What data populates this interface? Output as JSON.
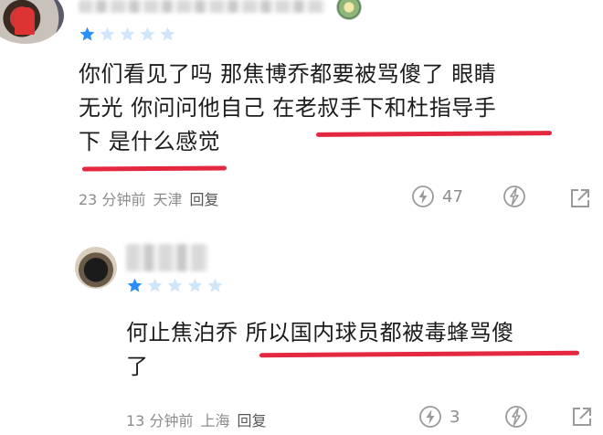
{
  "colors": {
    "star_filled": "#2c8ef8",
    "star_empty": "#cfe6fb",
    "highlight_underline": "#e3283f",
    "meta_text": "#8c8c8c"
  },
  "comments": [
    {
      "rating": 1,
      "lines": [
        "你们看见了吗 那焦博乔都要被骂傻了 眼睛",
        "无光 你问问他自己 在老叔手下和杜指导手",
        "下 是什么感觉"
      ],
      "time": "23 分钟前",
      "location": "天津",
      "reply_label": "回复",
      "likes": "47",
      "icons": [
        "lightning-like-icon",
        "dislike-icon",
        "share-icon"
      ]
    },
    {
      "rating": 1,
      "lines": [
        "何止焦泊乔 所以国内球员都被毒蜂骂傻",
        "了"
      ],
      "time": "13 分钟前",
      "location": "上海",
      "reply_label": "回复",
      "likes": "3",
      "icons": [
        "lightning-like-icon",
        "dislike-icon",
        "share-icon"
      ]
    }
  ]
}
